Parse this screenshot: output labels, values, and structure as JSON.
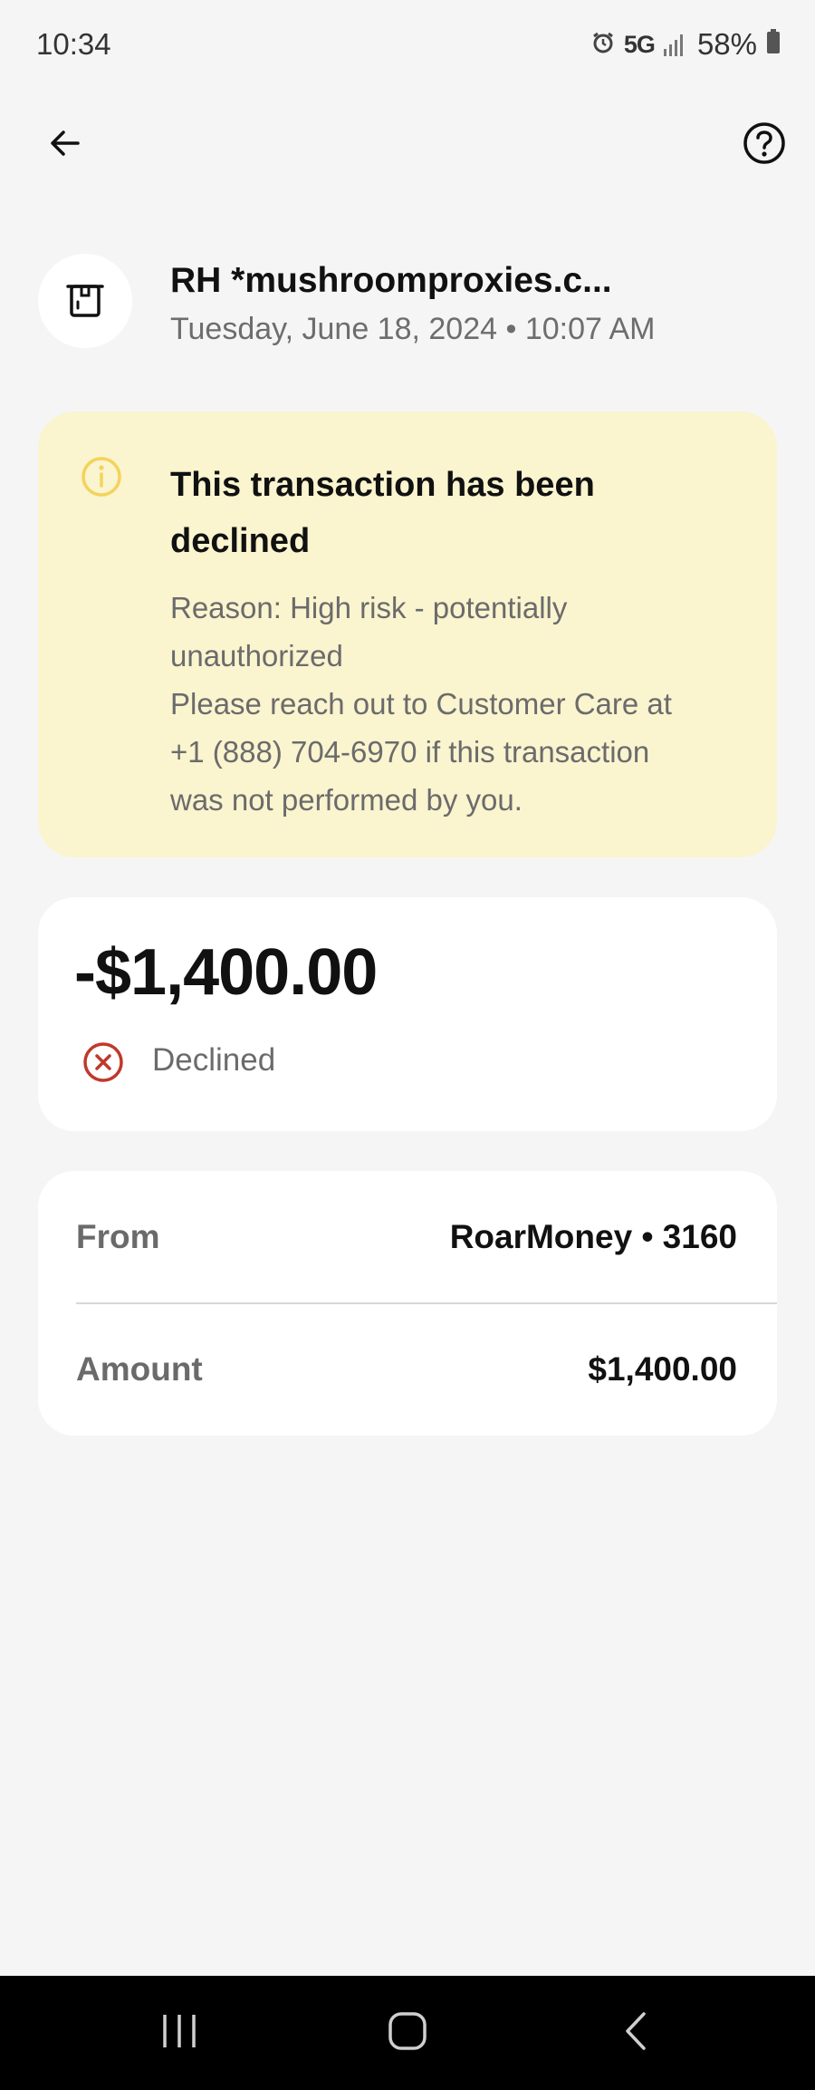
{
  "status_bar": {
    "time": "10:34",
    "network": "5G",
    "battery": "58%",
    "icons": [
      "alarm-icon",
      "signal-icon",
      "battery-icon"
    ]
  },
  "top_bar": {
    "back_icon": "arrow-left-icon",
    "help_icon": "question-circle-icon"
  },
  "merchant": {
    "logo_icon": "merchant-store-icon",
    "name": "RH *mushroomproxies.c...",
    "date": "Tuesday, June 18, 2024 • 10:07 AM"
  },
  "alert": {
    "icon": "info-circle-icon",
    "title": "This transaction has been declined",
    "body_lines": [
      "Reason: High risk - potentially",
      "unauthorized",
      "Please reach out to Customer Care at",
      "+1 (888) 704-6970 if this transaction",
      "was not performed by you."
    ],
    "background_color": "#faf4cf",
    "icon_color": "#f3d35a"
  },
  "amount": {
    "value": "-$1,400.00",
    "status_icon": "x-circle-icon",
    "status": "Declined",
    "status_color": "#c0392b"
  },
  "details": [
    {
      "label": "From",
      "value": "RoarMoney • 3160"
    },
    {
      "label": "Amount",
      "value": "$1,400.00"
    }
  ],
  "nav_bar": {
    "icons": [
      "recents-icon",
      "home-icon",
      "back-icon"
    ]
  }
}
